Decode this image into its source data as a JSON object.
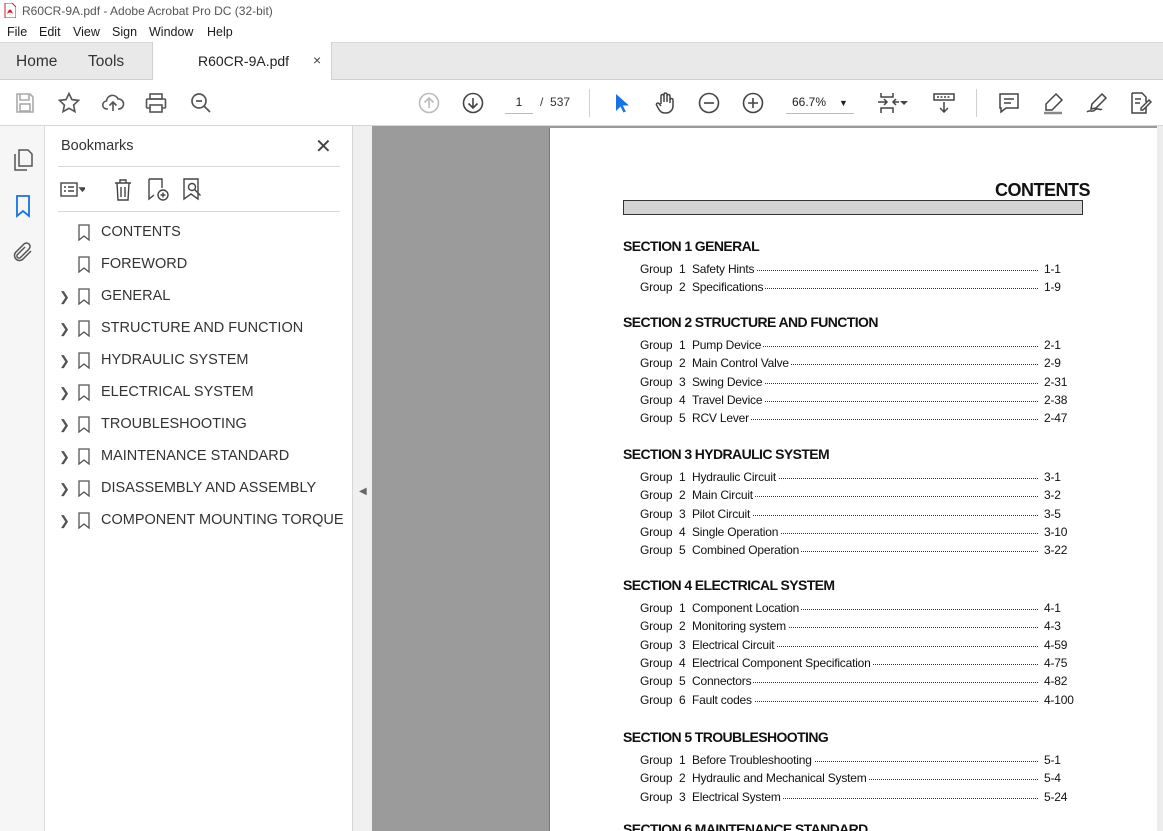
{
  "window": {
    "title": "R60CR-9A.pdf - Adobe Acrobat Pro DC (32-bit)"
  },
  "menu": [
    "File",
    "Edit",
    "View",
    "Sign",
    "Window",
    "Help"
  ],
  "tabs": {
    "home": "Home",
    "tools": "Tools",
    "document": "R60CR-9A.pdf",
    "close_glyph": "×"
  },
  "toolbar": {
    "current_page": "1",
    "page_separator": "/",
    "total_pages": "537",
    "zoom": "66.7%"
  },
  "bookmarks": {
    "header": "Bookmarks",
    "close_glyph": "✕",
    "items": [
      {
        "label": "CONTENTS",
        "expandable": false
      },
      {
        "label": "FOREWORD",
        "expandable": false
      },
      {
        "label": "GENERAL",
        "expandable": true
      },
      {
        "label": "STRUCTURE AND FUNCTION",
        "expandable": true
      },
      {
        "label": "HYDRAULIC SYSTEM",
        "expandable": true
      },
      {
        "label": "ELECTRICAL SYSTEM",
        "expandable": true
      },
      {
        "label": "TROUBLESHOOTING",
        "expandable": true
      },
      {
        "label": "MAINTENANCE STANDARD",
        "expandable": true
      },
      {
        "label": "DISASSEMBLY AND ASSEMBLY",
        "expandable": true
      },
      {
        "label": "COMPONENT MOUNTING TORQUE",
        "expandable": true
      }
    ]
  },
  "document": {
    "title": "CONTENTS",
    "sections": [
      {
        "heading": "SECTION 1  GENERAL",
        "groups": [
          {
            "group": "Group",
            "num": "1",
            "title": "Safety Hints",
            "page": "1-1"
          },
          {
            "group": "Group",
            "num": "2",
            "title": "Specifications",
            "page": "1-9"
          }
        ]
      },
      {
        "heading": "SECTION 2  STRUCTURE AND FUNCTION",
        "groups": [
          {
            "group": "Group",
            "num": "1",
            "title": "Pump Device",
            "page": "2-1"
          },
          {
            "group": "Group",
            "num": "2",
            "title": "Main Control Valve",
            "page": "2-9"
          },
          {
            "group": "Group",
            "num": "3",
            "title": "Swing Device",
            "page": "2-31"
          },
          {
            "group": "Group",
            "num": "4",
            "title": "Travel Device",
            "page": "2-38"
          },
          {
            "group": "Group",
            "num": "5",
            "title": "RCV Lever",
            "page": "2-47"
          }
        ]
      },
      {
        "heading": "SECTION 3  HYDRAULIC SYSTEM",
        "groups": [
          {
            "group": "Group",
            "num": "1",
            "title": "Hydraulic Circuit",
            "page": "3-1"
          },
          {
            "group": "Group",
            "num": "2",
            "title": "Main Circuit",
            "page": "3-2"
          },
          {
            "group": "Group",
            "num": "3",
            "title": "Pilot Circuit",
            "page": "3-5"
          },
          {
            "group": "Group",
            "num": "4",
            "title": "Single Operation",
            "page": "3-10"
          },
          {
            "group": "Group",
            "num": "5",
            "title": "Combined Operation",
            "page": "3-22"
          }
        ]
      },
      {
        "heading": "SECTION 4  ELECTRICAL SYSTEM",
        "groups": [
          {
            "group": "Group",
            "num": "1",
            "title": "Component Location",
            "page": "4-1"
          },
          {
            "group": "Group",
            "num": "2",
            "title": "Monitoring system",
            "page": "4-3"
          },
          {
            "group": "Group",
            "num": "3",
            "title": "Electrical Circuit",
            "page": "4-59"
          },
          {
            "group": "Group",
            "num": "4",
            "title": "Electrical Component Specification",
            "page": "4-75"
          },
          {
            "group": "Group",
            "num": "5",
            "title": "Connectors",
            "page": "4-82"
          },
          {
            "group": "Group",
            "num": "6",
            "title": "Fault codes",
            "page": "4-100"
          }
        ]
      },
      {
        "heading": "SECTION 5  TROUBLESHOOTING",
        "groups": [
          {
            "group": "Group",
            "num": "1",
            "title": "Before Troubleshooting",
            "page": "5-1"
          },
          {
            "group": "Group",
            "num": "2",
            "title": "Hydraulic and Mechanical System",
            "page": "5-4"
          },
          {
            "group": "Group",
            "num": "3",
            "title": "Electrical System",
            "page": "5-24"
          }
        ]
      },
      {
        "heading": "SECTION 6  MAINTENANCE STANDARD",
        "groups": []
      }
    ]
  },
  "colors": {
    "accent_blue": "#1473e6",
    "pdf_red": "#d42020",
    "doc_bg": "#9b9b9b"
  }
}
